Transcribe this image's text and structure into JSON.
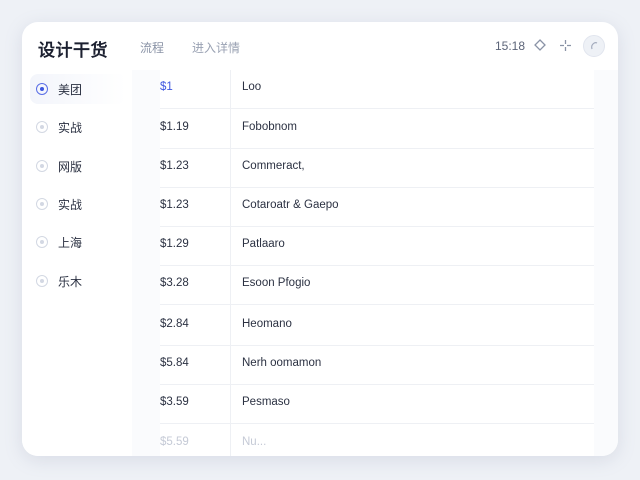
{
  "app": {
    "title": "设计干货"
  },
  "breadcrumb": {
    "first": "流程",
    "second": "进入详情"
  },
  "status": {
    "time": "15:18"
  },
  "header_icons": [
    "diamond-icon",
    "crosshair-icon"
  ],
  "sidebar": {
    "items": [
      {
        "label": "美团",
        "active": true
      },
      {
        "label": "实战",
        "active": false
      },
      {
        "label": "网版",
        "active": false
      },
      {
        "label": "实战",
        "active": false
      },
      {
        "label": "上海",
        "active": false
      },
      {
        "label": "乐木",
        "active": false
      }
    ]
  },
  "table": {
    "rows": [
      {
        "price": "$1",
        "name": "Loo"
      },
      {
        "price": "$1.19",
        "name": "Fobobnom"
      },
      {
        "price": "$1.23",
        "name": "Commeract,"
      },
      {
        "price": "$1.23",
        "name": "Cotaroatr & Gaepo"
      },
      {
        "price": "$1.29",
        "name": "Patlaaro"
      },
      {
        "price": "$3.28",
        "name": "Esoon Pfogio"
      },
      {
        "price": "$2.84",
        "name": "Heomano"
      },
      {
        "price": "$5.84",
        "name": "Nerh oomamon"
      },
      {
        "price": "$3.59",
        "name": "Pesmaso"
      },
      {
        "price": "$5.59",
        "name": "Nu..."
      }
    ]
  }
}
